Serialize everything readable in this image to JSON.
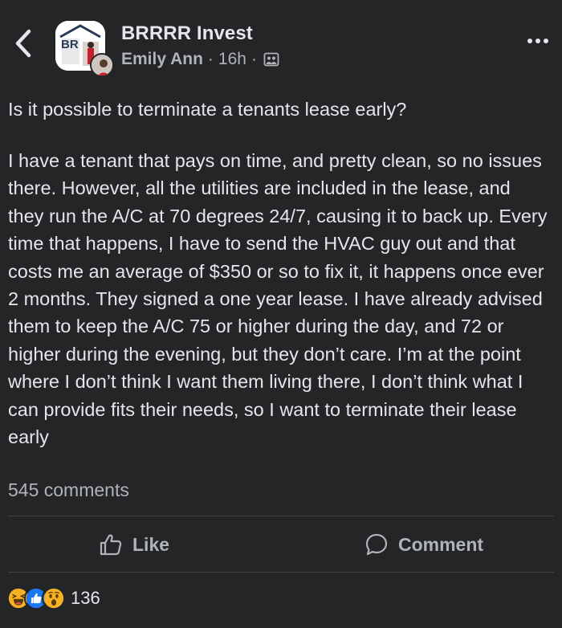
{
  "header": {
    "group_name": "BRRRR Invest",
    "author": "Emily Ann",
    "separator": "·",
    "timestamp": "16h",
    "avatar_text": "BR",
    "privacy_icon": "group-privacy-icon",
    "back_icon": "chevron-left-icon",
    "more_icon": "more-horizontal-icon"
  },
  "post": {
    "title": "Is it possible to terminate a tenants lease early?",
    "body": "I have a tenant that pays on time, and pretty clean, so no issues there. However, all the utilities are included in the lease, and they run the A/C at 70 degrees 24/7, causing it to back up. Every time that happens, I have to send the HVAC guy out and that costs me an average of $350 or so to fix it, it happens once ever 2 months. They signed a one year lease. I have already advised them to keep the A/C 75 or higher during the day, and 72 or higher during the evening, but they don’t care. I’m at the point where I don’t think I want them living there, I don’t think what I can provide fits their needs, so I want to terminate their lease early",
    "comments_count": "545 comments"
  },
  "actions": {
    "like_label": "Like",
    "comment_label": "Comment"
  },
  "reactions": {
    "icons": [
      "haha-icon",
      "like-icon",
      "wow-icon"
    ],
    "count": "136"
  },
  "colors": {
    "background": "#242526",
    "primary_text": "#e4e6eb",
    "secondary_text": "#b0b3b8",
    "like_blue": "#1877f2",
    "reaction_yellow": "#f7b125"
  }
}
